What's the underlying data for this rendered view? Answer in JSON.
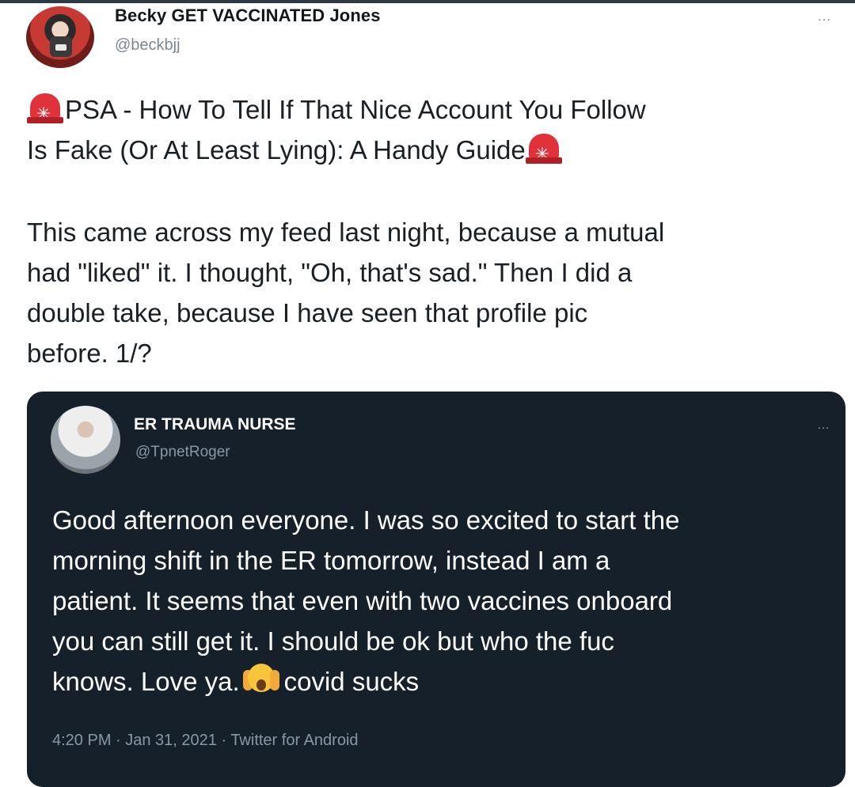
{
  "tweet": {
    "display_name": "Becky GET VACCINATED Jones",
    "handle": "@beckbjj",
    "more_glyph": "…",
    "title_line1": "PSA - How To Tell If That Nice Account You Follow",
    "title_line2": "Is Fake (Or At Least Lying): A Handy Guide",
    "body_lines": [
      "This came across my feed last night, because a mutual",
      "had \"liked\" it. I thought, \"Oh, that's sad.\" Then I did a",
      "double take, because I have seen that profile pic",
      "before. 1/?"
    ],
    "emoji_icon": "police-siren-icon"
  },
  "quoted_tweet": {
    "display_name": "ER TRAUMA NURSE",
    "handle": "@TpnetRoger",
    "more_glyph": "…",
    "text_lines": [
      "Good afternoon everyone. I was so excited to start the",
      "morning shift in the ER tomorrow, instead I am a",
      "patient. It seems that even with two vaccines onboard",
      "you can still get it. I should be ok but who the fuc"
    ],
    "last_line_before_emoji": "knows. Love ya.",
    "last_line_after_emoji": "covid sucks",
    "emoji_icon": "face-screaming-in-fear-icon",
    "meta": "4:20 PM · Jan 31, 2021 · Twitter for Android"
  },
  "colors": {
    "quote_background": "#15202b",
    "secondary_text": "#8899a6",
    "siren_red": "#e0323a"
  }
}
